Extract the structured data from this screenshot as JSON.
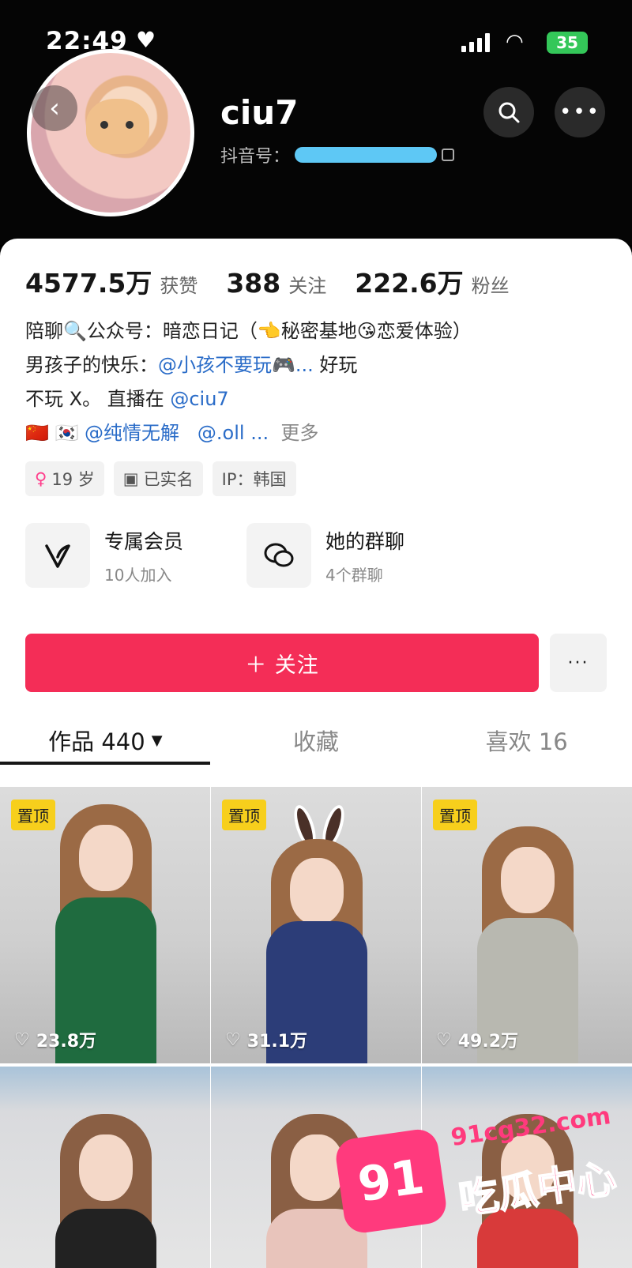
{
  "status_bar": {
    "time": "22:49",
    "battery": "35"
  },
  "profile": {
    "username": "ciu7",
    "douyin_id_label": "抖音号："
  },
  "stats": [
    {
      "value": "4577.5万",
      "label": "获赞"
    },
    {
      "value": "388",
      "label": "关注"
    },
    {
      "value": "222.6万",
      "label": "粉丝"
    }
  ],
  "bio": {
    "line1": "陪聊🔍公众号：暗恋日记（👈秘密基地😘恋爱体验）",
    "line2_prefix": "男孩子的快乐：",
    "line2_mention": "@小孩不要玩🎮...",
    "line2_suffix": " 好玩",
    "line3_prefix": "不玩 X。 直播在 ",
    "line3_mention": "@ciu7",
    "line4_flags": "🇨🇳 🇰🇷 ",
    "line4_mention1": "@纯情无解",
    "line4_mention2": "@.oll ...",
    "line4_more": "更多"
  },
  "tags": [
    {
      "icon": "female-icon",
      "text": "19 岁"
    },
    {
      "icon": "id-card-icon",
      "text": "已实名"
    },
    {
      "icon": "",
      "text": "IP：韩国"
    }
  ],
  "features": {
    "member": {
      "title": "专属会员",
      "sub": "10人加入"
    },
    "group": {
      "title": "她的群聊",
      "sub": "4个群聊"
    }
  },
  "actions": {
    "follow_label": "＋ 关注",
    "more_label": "···"
  },
  "tabs": [
    {
      "label": "作品 440",
      "active": true
    },
    {
      "label": "收藏",
      "active": false
    },
    {
      "label": "喜欢 16",
      "active": false
    }
  ],
  "videos": [
    {
      "pinned": "置顶",
      "likes": "23.8万",
      "outfit": "#1f6b3f"
    },
    {
      "pinned": "置顶",
      "likes": "31.1万",
      "outfit": "#2c3d78"
    },
    {
      "pinned": "置顶",
      "likes": "49.2万",
      "outfit": "#b8b8b0"
    },
    {
      "pinned": "",
      "likes": "",
      "outfit": "#222222"
    },
    {
      "pinned": "",
      "likes": "",
      "outfit": "#e8c4bb"
    },
    {
      "pinned": "",
      "likes": "",
      "outfit": "#d83a3a"
    }
  ],
  "watermark": {
    "number": "91",
    "url": "91cg32.com",
    "text": "吃瓜中心"
  },
  "colors": {
    "accent": "#f42d57",
    "mention": "#2a6cc8",
    "pin": "#f7cf1c"
  }
}
